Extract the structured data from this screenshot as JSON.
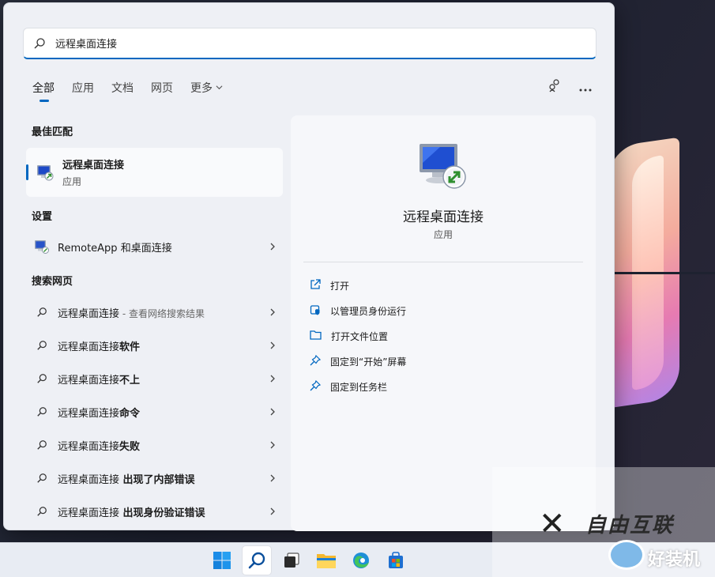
{
  "search": {
    "value": "远程桌面连接",
    "placeholder": ""
  },
  "tabs": [
    {
      "label": "全部"
    },
    {
      "label": "应用"
    },
    {
      "label": "文档"
    },
    {
      "label": "网页"
    },
    {
      "label": "更多"
    }
  ],
  "sections": {
    "best_match": "最佳匹配",
    "settings": "设置",
    "web": "搜索网页"
  },
  "best_match": {
    "title": "远程桌面连接",
    "type": "应用"
  },
  "settings_item": {
    "label": "RemoteApp 和桌面连接"
  },
  "web_results": [
    {
      "text": "远程桌面连接",
      "suffix": " - 查看网络搜索结果"
    },
    {
      "text": "远程桌面连接",
      "bold": "软件"
    },
    {
      "text": "远程桌面连接",
      "bold": "不上"
    },
    {
      "text": "远程桌面连接",
      "bold": "命令"
    },
    {
      "text": "远程桌面连接",
      "bold": "失败"
    },
    {
      "text": "远程桌面连接",
      "bold": " 出现了内部错误"
    },
    {
      "text": "远程桌面连接",
      "bold": " 出现身份验证错误"
    }
  ],
  "detail": {
    "name": "远程桌面连接",
    "type": "应用",
    "actions": [
      {
        "label": "打开",
        "icon": "open-external-icon"
      },
      {
        "label": "以管理员身份运行",
        "icon": "shield-admin-icon"
      },
      {
        "label": "打开文件位置",
        "icon": "folder-icon"
      },
      {
        "label": "固定到“开始”屏幕",
        "icon": "pin-icon"
      },
      {
        "label": "固定到任务栏",
        "icon": "pin-icon"
      }
    ]
  },
  "taskbar": {
    "items": [
      "windows-start-icon",
      "search-icon",
      "task-view-icon",
      "file-explorer-icon",
      "edge-browser-icon",
      "store-icon"
    ]
  },
  "watermark": {
    "line1": "自由互联",
    "line2": "好装机"
  },
  "colors": {
    "accent": "#0067c0",
    "panel_bg": "#eef0f5",
    "detail_bg": "#f6f7fa"
  }
}
